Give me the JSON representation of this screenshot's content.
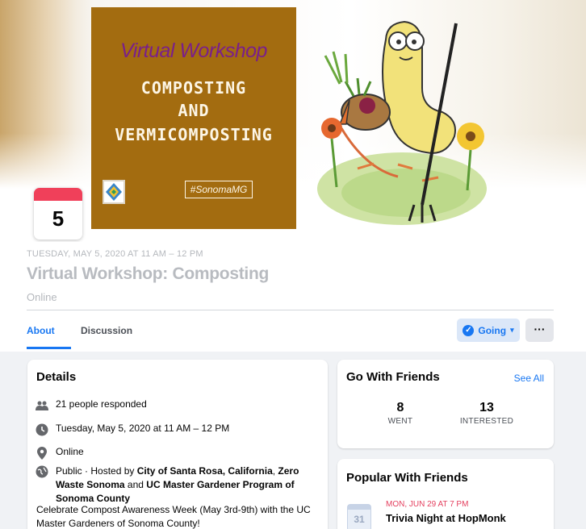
{
  "cover": {
    "poster_subtitle": "Virtual Workshop",
    "poster_line1": "COMPOSTING",
    "poster_line2": "AND",
    "poster_line3": "VERMICOMPOSTING",
    "poster_tag": "#SonomaMG",
    "art_icon": "worm-with-pitchfork-illustration"
  },
  "date_badge": {
    "day": "5",
    "accent": "#f0405a"
  },
  "event": {
    "date_line": "TUESDAY, MAY 5, 2020 AT 11 AM – 12 PM",
    "title": "Virtual Workshop: Composting",
    "location": "Online"
  },
  "tabs": {
    "about": "About",
    "discussion": "Discussion"
  },
  "actions": {
    "going_label": "Going",
    "more_label": "···"
  },
  "details": {
    "title": "Details",
    "responded": "21 people responded",
    "time": "Tuesday, May 5, 2020 at 11 AM – 12 PM",
    "location": "Online",
    "host_prefix": "Public · Hosted by ",
    "host_a": "City of Santa Rosa, California",
    "host_sep1": ", ",
    "host_b": "Zero Waste Sonoma",
    "host_sep2": " and ",
    "host_c": "UC Master Gardener Program of Sonoma County",
    "description": "Celebrate Compost Awareness Week (May 3rd-9th) with the UC Master Gardeners of Sonoma County!"
  },
  "go_with_friends": {
    "title": "Go With Friends",
    "see_all": "See All",
    "went_count": "8",
    "went_label": "WENT",
    "interested_count": "13",
    "interested_label": "INTERESTED"
  },
  "popular": {
    "title": "Popular With Friends",
    "calendar_day": "31",
    "event_date": "MON, JUN 29 AT 7 PM",
    "event_name": "Trivia Night at HopMonk"
  },
  "colors": {
    "brand": "#1877f2",
    "poster": "#a36c10",
    "feed_bg": "#f0f2f5"
  }
}
